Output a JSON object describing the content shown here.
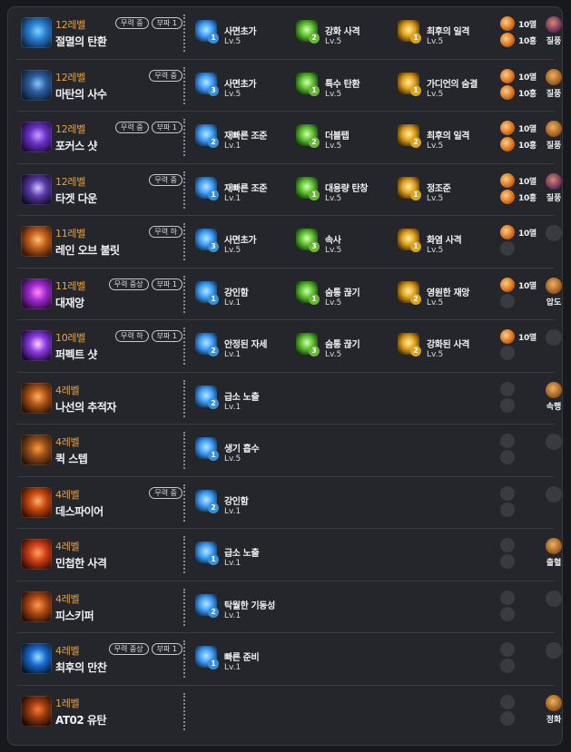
{
  "skills": [
    {
      "level": "12레벨",
      "name": "절멸의 탄환",
      "badges": [
        "무력 중",
        "부파 1"
      ],
      "icon_colors": [
        "#0b2a4a",
        "#2a7fd0",
        "#7fd2ff"
      ],
      "tripods": [
        {
          "name": "사면초가",
          "lv": "Lv.5",
          "tier": "1",
          "color": "blue"
        },
        {
          "name": "강화 사격",
          "lv": "Lv.5",
          "tier": "2",
          "color": "green"
        },
        {
          "name": "최후의 일격",
          "lv": "Lv.5",
          "tier": "1",
          "color": "gold"
        }
      ],
      "gems": [
        {
          "filled": true,
          "label": "10멸"
        },
        {
          "filled": true,
          "label": "10홍"
        }
      ],
      "rune": {
        "type": "purple",
        "label": "질풍"
      }
    },
    {
      "level": "12레벨",
      "name": "마탄의 사수",
      "badges": [
        "무력 중"
      ],
      "icon_colors": [
        "#0d1f38",
        "#2c5e9e",
        "#88c4ff"
      ],
      "tripods": [
        {
          "name": "사면초가",
          "lv": "Lv.5",
          "tier": "3",
          "color": "blue"
        },
        {
          "name": "특수 탄환",
          "lv": "Lv.5",
          "tier": "1",
          "color": "green"
        },
        {
          "name": "가디언의 숨결",
          "lv": "Lv.5",
          "tier": "1",
          "color": "gold"
        }
      ],
      "gems": [
        {
          "filled": true,
          "label": "10멸"
        },
        {
          "filled": true,
          "label": "10홍"
        }
      ],
      "rune": {
        "type": "gold",
        "label": "질풍"
      }
    },
    {
      "level": "12레벨",
      "name": "포커스 샷",
      "badges": [
        "무력 중",
        "부파 1"
      ],
      "icon_colors": [
        "#1e0b3a",
        "#6a32c8",
        "#c7a0ff"
      ],
      "tripods": [
        {
          "name": "재빠른 조준",
          "lv": "Lv.1",
          "tier": "2",
          "color": "blue"
        },
        {
          "name": "더블탭",
          "lv": "Lv.5",
          "tier": "2",
          "color": "green"
        },
        {
          "name": "최후의 일격",
          "lv": "Lv.5",
          "tier": "2",
          "color": "gold"
        }
      ],
      "gems": [
        {
          "filled": true,
          "label": "10멸"
        },
        {
          "filled": true,
          "label": "10홍"
        }
      ],
      "rune": {
        "type": "gold",
        "label": "질풍"
      }
    },
    {
      "level": "12레벨",
      "name": "타겟 다운",
      "badges": [
        "무력 중"
      ],
      "icon_colors": [
        "#120a2a",
        "#5a3aa8",
        "#d4c4ff"
      ],
      "tripods": [
        {
          "name": "재빠른 조준",
          "lv": "Lv.1",
          "tier": "1",
          "color": "blue"
        },
        {
          "name": "대용량 탄창",
          "lv": "Lv.5",
          "tier": "1",
          "color": "green"
        },
        {
          "name": "정조준",
          "lv": "Lv.5",
          "tier": "1",
          "color": "gold"
        }
      ],
      "gems": [
        {
          "filled": true,
          "label": "10멸"
        },
        {
          "filled": true,
          "label": "10홍"
        }
      ],
      "rune": {
        "type": "purple",
        "label": "질풍"
      }
    },
    {
      "level": "11레벨",
      "name": "레인 오브 불릿",
      "badges": [
        "무력 하"
      ],
      "icon_colors": [
        "#3a1606",
        "#c2601c",
        "#ffc07a"
      ],
      "tripods": [
        {
          "name": "사면초가",
          "lv": "Lv.5",
          "tier": "3",
          "color": "blue"
        },
        {
          "name": "속사",
          "lv": "Lv.5",
          "tier": "3",
          "color": "green"
        },
        {
          "name": "화염 사격",
          "lv": "Lv.5",
          "tier": "1",
          "color": "gold"
        }
      ],
      "gems": [
        {
          "filled": true,
          "label": "10멸"
        },
        {
          "filled": false,
          "label": ""
        }
      ],
      "rune": {
        "type": "empty",
        "label": ""
      }
    },
    {
      "level": "11레벨",
      "name": "대재앙",
      "badges": [
        "무력 중상",
        "부파 1"
      ],
      "icon_colors": [
        "#2a0a3a",
        "#a02ad0",
        "#ff8cf0"
      ],
      "tripods": [
        {
          "name": "강인함",
          "lv": "Lv.1",
          "tier": "1",
          "color": "blue"
        },
        {
          "name": "숨통 끊기",
          "lv": "Lv.5",
          "tier": "1",
          "color": "green"
        },
        {
          "name": "영원한 재앙",
          "lv": "Lv.5",
          "tier": "2",
          "color": "gold"
        }
      ],
      "gems": [
        {
          "filled": true,
          "label": "10멸"
        },
        {
          "filled": false,
          "label": ""
        }
      ],
      "rune": {
        "type": "gold",
        "label": "압도"
      }
    },
    {
      "level": "10레벨",
      "name": "퍼펙트 샷",
      "badges": [
        "무력 하",
        "부파 1"
      ],
      "icon_colors": [
        "#1a0838",
        "#8a3ae0",
        "#ffd4ff"
      ],
      "tripods": [
        {
          "name": "안정된 자세",
          "lv": "Lv.1",
          "tier": "2",
          "color": "blue"
        },
        {
          "name": "숨통 끊기",
          "lv": "Lv.5",
          "tier": "3",
          "color": "green"
        },
        {
          "name": "강화된 사격",
          "lv": "Lv.5",
          "tier": "2",
          "color": "gold"
        }
      ],
      "gems": [
        {
          "filled": true,
          "label": "10멸"
        },
        {
          "filled": false,
          "label": ""
        }
      ],
      "rune": {
        "type": "empty",
        "label": ""
      }
    },
    {
      "level": "4레벨",
      "name": "나선의 추적자",
      "badges": [],
      "icon_colors": [
        "#2a1204",
        "#b05418",
        "#ffb060"
      ],
      "tripods": [
        {
          "name": "급소 노출",
          "lv": "Lv.1",
          "tier": "2",
          "color": "blue"
        }
      ],
      "gems": [
        {
          "filled": false,
          "label": ""
        },
        {
          "filled": false,
          "label": ""
        }
      ],
      "rune": {
        "type": "gold",
        "label": "속행"
      }
    },
    {
      "level": "4레벨",
      "name": "퀵 스텝",
      "badges": [],
      "icon_colors": [
        "#2a1404",
        "#9a5018",
        "#ff9a40"
      ],
      "tripods": [
        {
          "name": "생기 흡수",
          "lv": "Lv.5",
          "tier": "1",
          "color": "blue"
        }
      ],
      "gems": [
        {
          "filled": false,
          "label": ""
        },
        {
          "filled": false,
          "label": ""
        }
      ],
      "rune": {
        "type": "empty",
        "label": ""
      }
    },
    {
      "level": "4레벨",
      "name": "데스파이어",
      "badges": [
        "무력 중"
      ],
      "icon_colors": [
        "#3a1004",
        "#c84a10",
        "#ffb070"
      ],
      "tripods": [
        {
          "name": "강인함",
          "lv": "Lv.1",
          "tier": "2",
          "color": "blue"
        }
      ],
      "gems": [
        {
          "filled": false,
          "label": ""
        },
        {
          "filled": false,
          "label": ""
        }
      ],
      "rune": {
        "type": "empty",
        "label": ""
      }
    },
    {
      "level": "4레벨",
      "name": "민첩한 사격",
      "badges": [],
      "icon_colors": [
        "#3a0c04",
        "#d04018",
        "#ffa060"
      ],
      "tripods": [
        {
          "name": "급소 노출",
          "lv": "Lv.1",
          "tier": "1",
          "color": "blue"
        }
      ],
      "gems": [
        {
          "filled": false,
          "label": ""
        },
        {
          "filled": false,
          "label": ""
        }
      ],
      "rune": {
        "type": "gold",
        "label": "출혈"
      }
    },
    {
      "level": "4레벨",
      "name": "피스키퍼",
      "badges": [],
      "icon_colors": [
        "#2a0e04",
        "#b04a14",
        "#ff9a4a"
      ],
      "tripods": [
        {
          "name": "탁월한 기동성",
          "lv": "Lv.1",
          "tier": "2",
          "color": "blue"
        }
      ],
      "gems": [
        {
          "filled": false,
          "label": ""
        },
        {
          "filled": false,
          "label": ""
        }
      ],
      "rune": {
        "type": "empty",
        "label": ""
      }
    },
    {
      "level": "4레벨",
      "name": "최후의 만찬",
      "badges": [
        "무력 중상",
        "부파 1"
      ],
      "icon_colors": [
        "#06162a",
        "#1a6ad0",
        "#9ae0ff"
      ],
      "tripods": [
        {
          "name": "빠른 준비",
          "lv": "Lv.1",
          "tier": "1",
          "color": "blue"
        }
      ],
      "gems": [
        {
          "filled": false,
          "label": ""
        },
        {
          "filled": false,
          "label": ""
        }
      ],
      "rune": {
        "type": "empty",
        "label": ""
      }
    },
    {
      "level": "1레벨",
      "name": "AT02 유탄",
      "badges": [],
      "icon_colors": [
        "#1a0a04",
        "#9a3a10",
        "#ff7a30"
      ],
      "tripods": [],
      "gems": [
        {
          "filled": false,
          "label": ""
        },
        {
          "filled": false,
          "label": ""
        }
      ],
      "rune": {
        "type": "gold",
        "label": "정화"
      }
    }
  ]
}
